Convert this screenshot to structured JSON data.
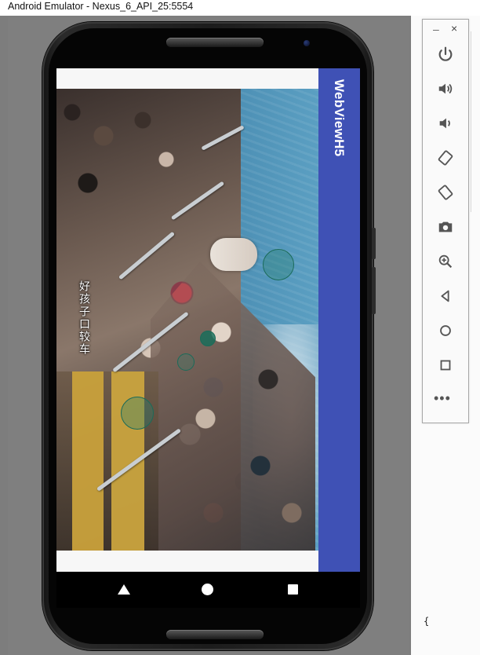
{
  "window": {
    "title": "Android Emulator - Nexus_6_API_25:5554"
  },
  "app": {
    "title": "WebViewH5"
  },
  "video": {
    "subtitle": "好孩子口较车"
  },
  "navbar": {
    "back": "back-icon",
    "home": "home-icon",
    "recents": "recents-icon"
  },
  "toolbar": {
    "minimize_label": "–",
    "close_label": "×",
    "more_label": "•••",
    "buttons": [
      "power-icon",
      "volume-up-icon",
      "volume-down-icon",
      "rotate-left-icon",
      "rotate-right-icon",
      "camera-icon",
      "zoom-icon",
      "back-icon",
      "home-icon",
      "overview-icon"
    ]
  },
  "ide": {
    "brace": "{"
  },
  "colors": {
    "appbar": "#3f51b5",
    "ripple": "#1a6b59"
  }
}
